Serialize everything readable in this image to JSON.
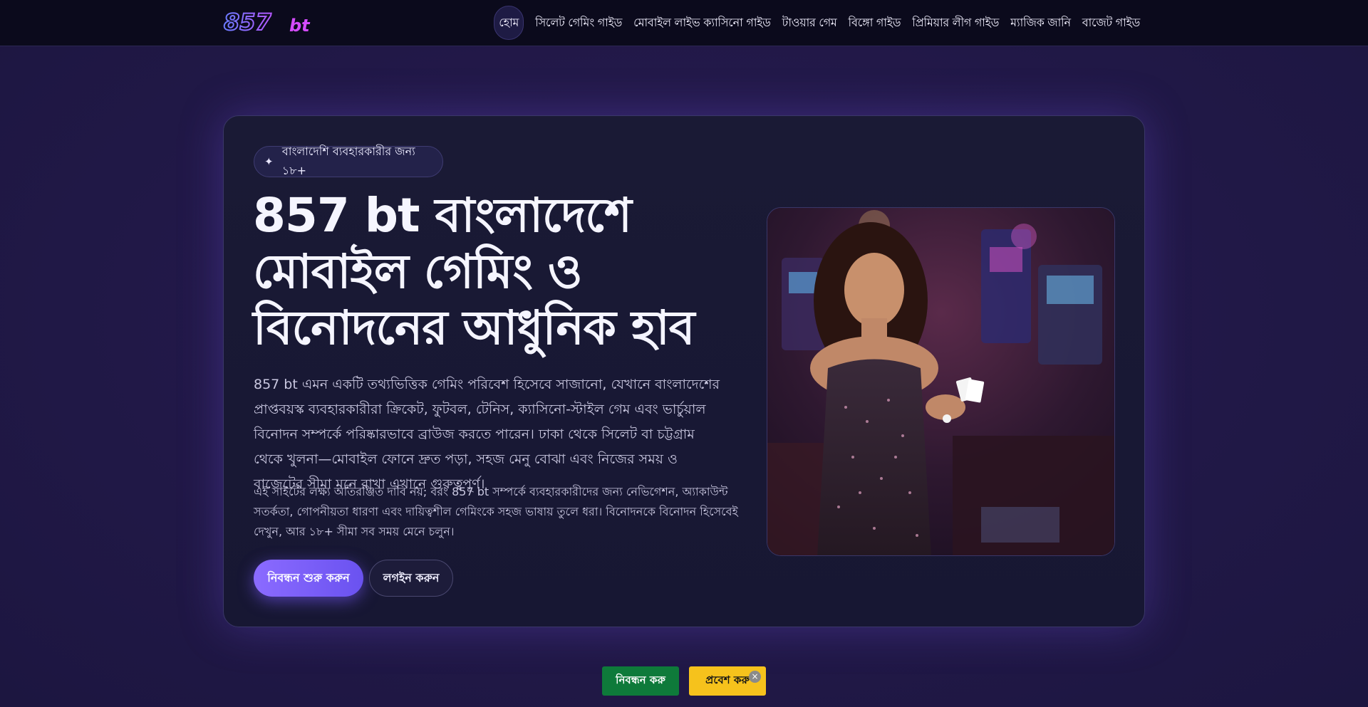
{
  "header": {
    "logo_text": "857bt",
    "nav": [
      {
        "label": "হোম"
      },
      {
        "label": "সিলেট গেমিং গাইড"
      },
      {
        "label": "মোবাইল লাইভ ক্যাসিনো গাইড"
      },
      {
        "label": "টাওয়ার গেম"
      },
      {
        "label": "বিঙ্গো গাইড"
      },
      {
        "label": "প্রিমিয়ার লীগ গাইড"
      },
      {
        "label": "ম্যাজিক জানি"
      },
      {
        "label": "বাজেট গাইড"
      }
    ]
  },
  "hero": {
    "badge": "বাংলাদেশি ব্যবহারকারীর জন্য ১৮+",
    "headline": "857 bt বাংলাদেশে মোবাইল গেমিং ও বিনোদনের আধুনিক হাব",
    "lead": "857 bt এমন একটি তথ্যভিত্তিক গেমিং পরিবেশ হিসেবে সাজানো, যেখানে বাংলাদেশের প্রাপ্তবয়স্ক ব্যবহারকারীরা ক্রিকেট, ফুটবল, টেনিস, ক্যাসিনো-স্টাইল গেম এবং ভার্চুয়াল বিনোদন সম্পর্কে পরিষ্কারভাবে ব্রাউজ করতে পারেন। ঢাকা থেকে সিলেট বা চট্টগ্রাম থেকে খুলনা—মোবাইল ফোনে দ্রুত পড়া, সহজ মেনু বোঝা এবং নিজের সময় ও বাজেটের সীমা মনে রাখা এখানে গুরুত্বপূর্ণ।",
    "sub": "এই সাইটের লক্ষ্য অতিরঞ্জিত দাবি নয়; বরং 857 bt সম্পর্কে ব্যবহারকারীদের জন্য নেভিগেশন, অ্যাকাউন্ট সতর্কতা, গোপনীয়তা ধারণা এবং দায়িত্বশীল গেমিংকে সহজ ভাষায় তুলে ধরা। বিনোদনকে বিনোদন হিসেবেই দেখুন, আর ১৮+ সীমা সব সময় মেনে চলুন।",
    "primary_button": "নিবন্ধন শুরু করুন",
    "secondary_button": "লগইন করুন"
  },
  "sticky": {
    "register": "নিবন্ধন করু",
    "login": "প্রবেশ করু",
    "close": "×"
  },
  "colors": {
    "accent": "#7b5cff",
    "register_green": "#0e7a3a",
    "login_yellow": "#f6c21c"
  }
}
